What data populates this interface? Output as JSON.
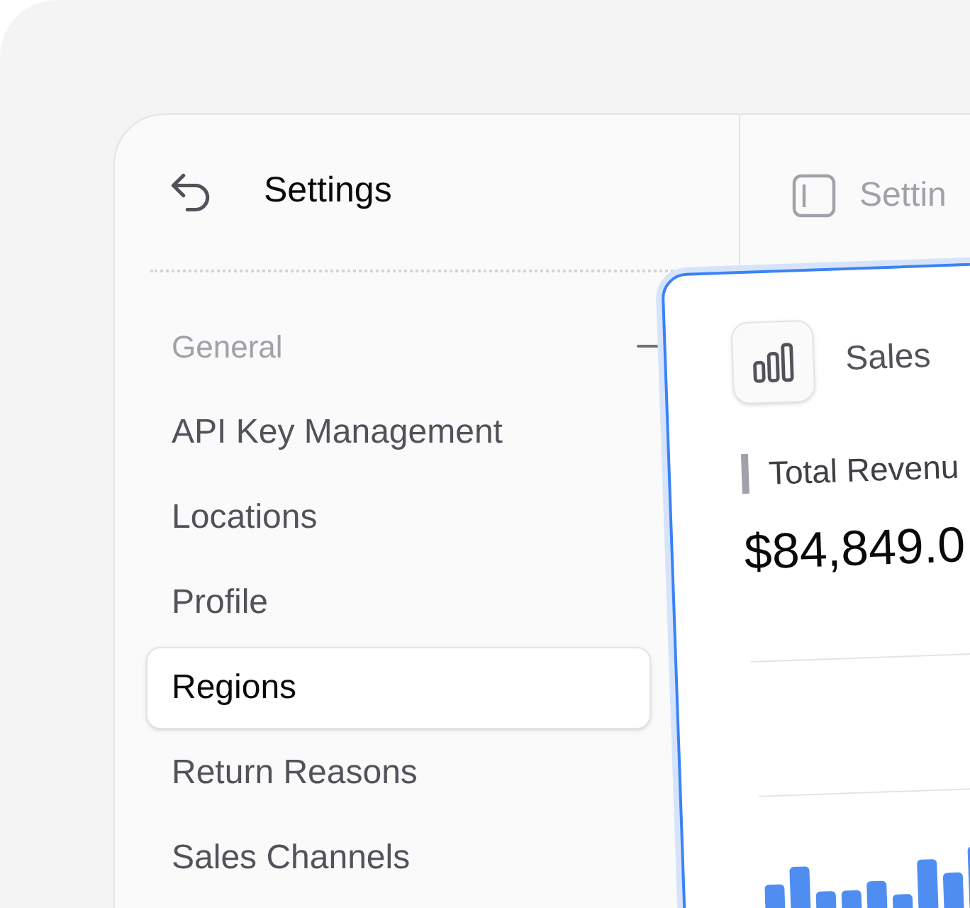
{
  "sidebar": {
    "title": "Settings",
    "section": {
      "label": "General",
      "expanded": true
    },
    "items": [
      {
        "label": "API Key Management",
        "selected": false
      },
      {
        "label": "Locations",
        "selected": false
      },
      {
        "label": "Profile",
        "selected": false
      },
      {
        "label": "Regions",
        "selected": true
      },
      {
        "label": "Return Reasons",
        "selected": false
      },
      {
        "label": "Sales Channels",
        "selected": false
      }
    ]
  },
  "header": {
    "title": "Settin"
  },
  "card": {
    "title": "Sales",
    "metric_label": "Total Revenu",
    "metric_value": "$84,849.0"
  }
}
